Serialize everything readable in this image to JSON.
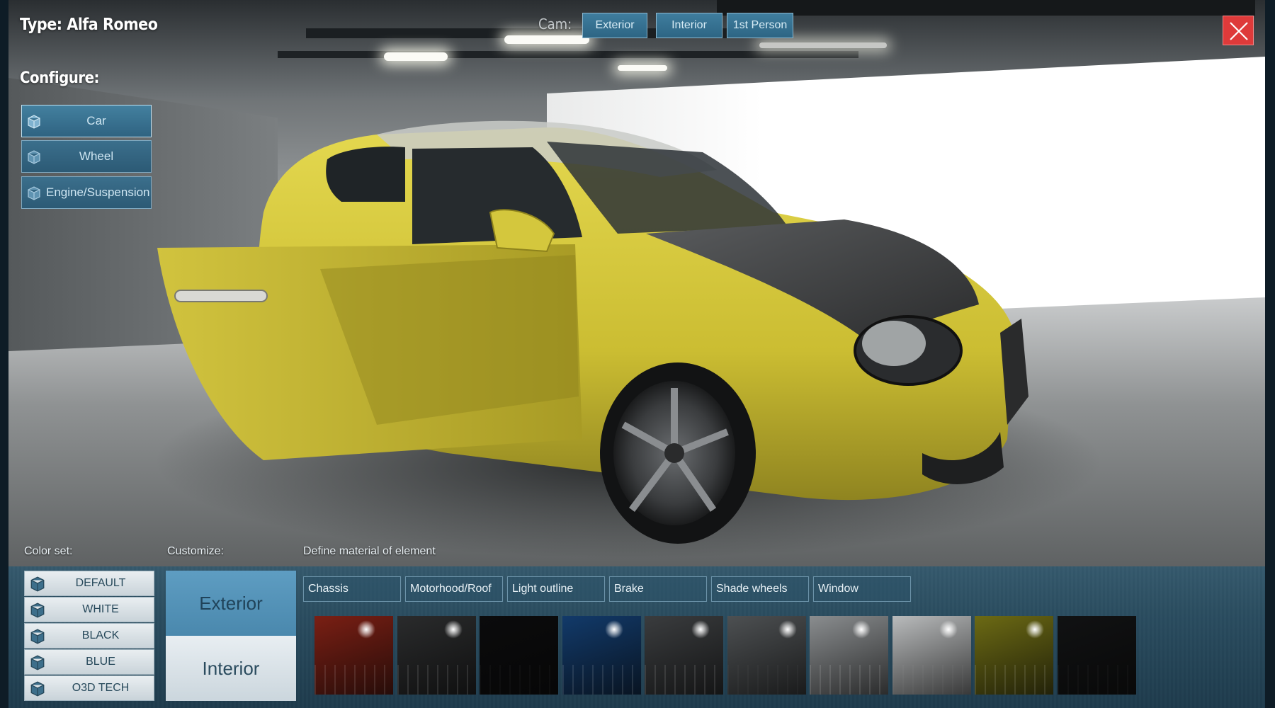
{
  "header": {
    "type_label": "Type: Alfa Romeo",
    "camera_label": "Cam:",
    "camera_tabs": [
      {
        "label": "Exterior"
      },
      {
        "label": "Interior"
      },
      {
        "label": "1st Person"
      }
    ],
    "close_icon": "close-icon"
  },
  "configure": {
    "title": "Configure:",
    "items": [
      {
        "label": "Car",
        "icon": "cube-icon",
        "active": true
      },
      {
        "label": "Wheel",
        "icon": "cube-icon",
        "active": false
      },
      {
        "label": "Engine/Suspension",
        "icon": "cube-icon",
        "active": false
      }
    ]
  },
  "bottom_panel": {
    "color_set_label": "Color set:",
    "customize_label": "Customize:",
    "define_label": "Define material of element",
    "color_sets": [
      {
        "label": "DEFAULT",
        "icon": "cube-icon"
      },
      {
        "label": "WHITE",
        "icon": "cube-icon"
      },
      {
        "label": "BLACK",
        "icon": "cube-icon"
      },
      {
        "label": "BLUE",
        "icon": "cube-icon"
      },
      {
        "label": "O3D TECH",
        "icon": "cube-icon"
      }
    ],
    "customize": {
      "exterior": "Exterior",
      "interior": "Interior",
      "selected": "Exterior"
    },
    "elements": [
      {
        "label": "Chassis"
      },
      {
        "label": "Motorhood/Roof"
      },
      {
        "label": "Light outline"
      },
      {
        "label": "Brake"
      },
      {
        "label": "Shade wheels"
      },
      {
        "label": "Window"
      }
    ],
    "material_swatches": [
      {
        "name": "red-material",
        "color": "#7a1f14"
      },
      {
        "name": "dark-chrome-material",
        "color": "#2a2b2c"
      },
      {
        "name": "black-material",
        "color": "#0b0b0c"
      },
      {
        "name": "blue-material",
        "color": "#123a6a"
      },
      {
        "name": "gunmetal-material",
        "color": "#3a3c3e"
      },
      {
        "name": "graphite-material",
        "color": "#4d5052"
      },
      {
        "name": "silver-material",
        "color": "#8a8d8f"
      },
      {
        "name": "light-grey-material",
        "color": "#b9bbbc"
      },
      {
        "name": "yellow-material",
        "color": "#6c6a14"
      },
      {
        "name": "carbon-material",
        "color": "#111213"
      }
    ]
  },
  "colors": {
    "accent": "#3b6f8c",
    "close_button": "#de3a3a",
    "car_body": "#d6c93c"
  }
}
